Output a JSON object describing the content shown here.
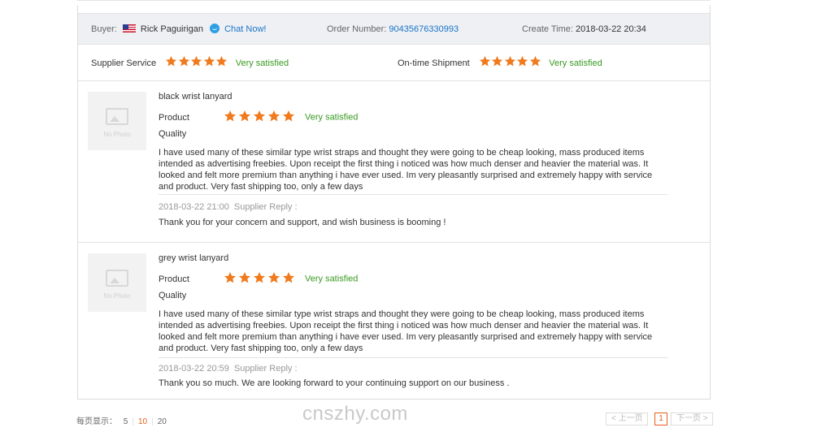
{
  "header": {
    "buyer_label": "Buyer:",
    "buyer_name": "Rick Paguirigan",
    "chat_label": "Chat Now!",
    "order_label": "Order Number:",
    "order_number": "90435676330993",
    "create_label": "Create Time:",
    "create_time": "2018-03-22 20:34"
  },
  "ratings": {
    "supplier_service_label": "Supplier Service",
    "supplier_service_stars": 5,
    "supplier_service_text": "Very satisfied",
    "ontime_label": "On-time Shipment",
    "ontime_stars": 5,
    "ontime_text": "Very satisfied"
  },
  "reviews": [
    {
      "product_name": "black wrist lanyard",
      "thumb_text": "No Photo",
      "product_label": "Product",
      "product_stars": 5,
      "product_text": "Very satisfied",
      "quality_label": "Quality",
      "review_text": "I have used many of these similar type wrist straps and thought they were going to be cheap looking, mass produced items intended as advertising freebies. Upon receipt the first thing i noticed was how much denser and heavier the material was. It looked and felt more premium than anything i have ever used. Im very pleasantly surprised and extremely happy with service and product. Very fast shipping too, only a few days",
      "reply_time": "2018-03-22 21:00",
      "reply_label": "Supplier Reply :",
      "reply_text": "Thank you for your concern and support, and wish business is booming !"
    },
    {
      "product_name": "grey wrist lanyard",
      "thumb_text": "No Photo",
      "product_label": "Product",
      "product_stars": 5,
      "product_text": "Very satisfied",
      "quality_label": "Quality",
      "review_text": "I have used many of these similar type wrist straps and thought they were going to be cheap looking, mass produced items intended as advertising freebies. Upon receipt the first thing i noticed was how much denser and heavier the material was. It looked and felt more premium than anything i have ever used. Im very pleasantly surprised and extremely happy with service and product. Very fast shipping too, only a few days",
      "reply_time": "2018-03-22 20:59",
      "reply_label": "Supplier Reply :",
      "reply_text": "Thank you so much. We are looking forward to your continuing support on our business ."
    }
  ],
  "pager": {
    "per_page_label": "每页显示：",
    "sizes": [
      "5",
      "10",
      "20"
    ],
    "prev_label": "< 上一页",
    "current_page": "1",
    "next_label": "下一页 >"
  },
  "watermark": "cnszhy.com",
  "colors": {
    "star": "#f07a1c",
    "satisfied": "#3a9a22",
    "link": "#1a73c8",
    "accent": "#e8601c"
  }
}
